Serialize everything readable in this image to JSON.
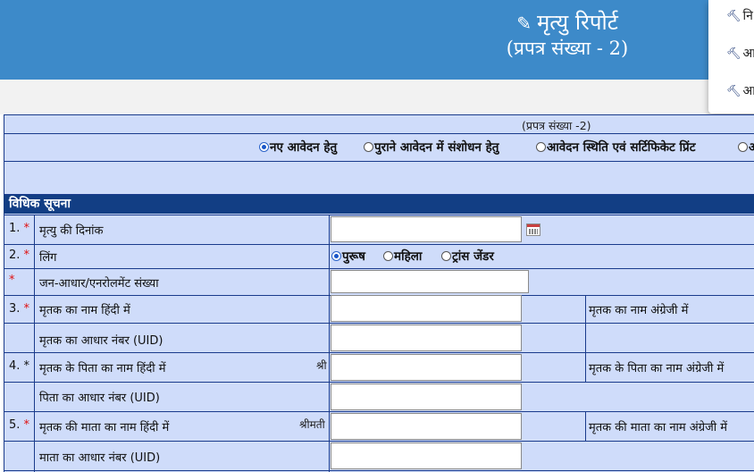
{
  "header": {
    "title": "मृत्यु रिपोर्ट",
    "subtitle": "(प्रपत्र संख्या - 2)",
    "icon": "edit-icon"
  },
  "dropdown": {
    "items": [
      {
        "label": "नि"
      },
      {
        "label": "आ"
      },
      {
        "label": "आ"
      }
    ]
  },
  "form": {
    "caption": "(प्रपत्र संख्या -2)",
    "mode_options": [
      {
        "label": "नए आवेदन हेतु",
        "selected": true
      },
      {
        "label": "पुराने आवेदन में संशोधन हेतु",
        "selected": false
      },
      {
        "label": "आवेदन स्थिति एवं सर्टिफिकेट प्रिंट",
        "selected": false
      },
      {
        "label": "अ",
        "selected": false
      }
    ],
    "section_title": "विधिक सूचना",
    "rows": [
      {
        "num": "1.",
        "req": "*",
        "label": "मृत्यु की दिनांक"
      },
      {
        "num": "2.",
        "req": "*",
        "label": "लिंग"
      },
      {
        "num": "",
        "req": "*",
        "label": "जन-आधार/एनरोलमेंट संख्या"
      },
      {
        "num": "3.",
        "req": "*",
        "label": "मृतक का नाम हिंदी में",
        "right_label": "मृतक का नाम अंग्रेजी में"
      },
      {
        "num": "",
        "req": "",
        "label": "मृतक का आधार नंबर (UID)"
      },
      {
        "num": "4.",
        "req": "*",
        "label": "मृतक के पिता का नाम हिंदी में",
        "prefix": "श्री",
        "right_label": "मृतक के पिता का नाम अंग्रेजी में"
      },
      {
        "num": "",
        "req": "",
        "label": "पिता का आधार नंबर (UID)"
      },
      {
        "num": "5.",
        "req": "*",
        "label": "मृतक की माता का नाम हिंदी में",
        "prefix": "श्रीमती",
        "right_label": "मृतक की माता का नाम अंग्रेजी में"
      },
      {
        "num": "",
        "req": "",
        "label": "माता का आधार नंबर (UID)"
      }
    ],
    "gender_options": [
      {
        "label": "पुरूष",
        "selected": true
      },
      {
        "label": "महिला",
        "selected": false
      },
      {
        "label": "ट्रांस जेंडर",
        "selected": false
      }
    ]
  },
  "colors": {
    "banner": "#3d8ac9",
    "form_bg": "#cfdcfa",
    "section_bg": "#123e84",
    "required": "#e01010"
  }
}
